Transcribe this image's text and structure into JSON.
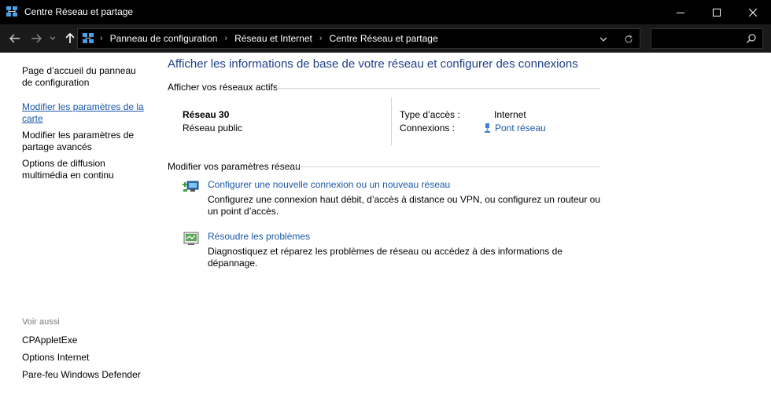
{
  "window": {
    "title": "Centre Réseau et partage"
  },
  "address": {
    "breadcrumbs": [
      "Panneau de configuration",
      "Réseau et Internet",
      "Centre Réseau et partage"
    ],
    "search_placeholder": ""
  },
  "sidebar": {
    "links": [
      {
        "label": "Page d’accueil du panneau de configuration"
      },
      {
        "label": "Modifier les paramètres de la carte"
      },
      {
        "label": "Modifier les paramètres de partage avancés"
      },
      {
        "label": "Options de diffusion multimédia en continu"
      }
    ],
    "see_also_title": "Voir aussi",
    "see_also": [
      {
        "label": "CPAppletExe"
      },
      {
        "label": "Options Internet"
      },
      {
        "label": "Pare-feu Windows Defender"
      }
    ]
  },
  "main": {
    "title": "Afficher les informations de base de votre réseau et configurer des connexions",
    "active_networks_heading": "Afficher vos réseaux actifs",
    "network": {
      "name": "Réseau 30",
      "type": "Réseau public",
      "access_type_label": "Type d’accès :",
      "access_type_value": "Internet",
      "connections_label": "Connexions :",
      "connections_value": "Pont réseau"
    },
    "modify_heading": "Modifier vos paramètres réseau",
    "tasks": [
      {
        "link": "Configurer une nouvelle connexion ou un nouveau réseau",
        "description": "Configurez une connexion haut débit, d’accès à distance ou VPN, ou configurez un routeur ou un point d’accès.",
        "icon": "new-connection-icon"
      },
      {
        "link": "Résoudre les problèmes",
        "description": "Diagnostiquez et réparez les problèmes de réseau ou accédez à des informations de dépannage.",
        "icon": "troubleshoot-icon"
      }
    ]
  },
  "colors": {
    "titlebar": "#000000",
    "addressbar": "#1a1a1a",
    "link": "#1a58a8",
    "heading": "#1e3f8a"
  }
}
